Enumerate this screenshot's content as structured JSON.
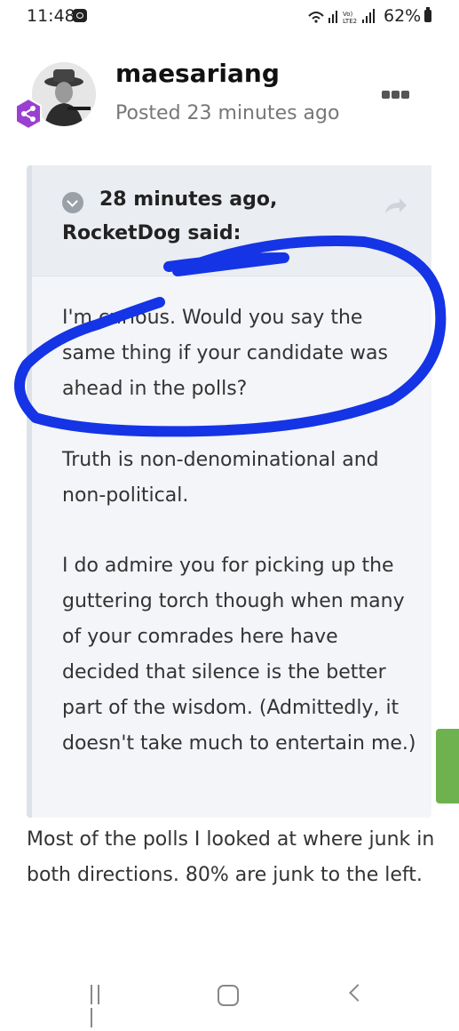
{
  "status_bar": {
    "time": "11:48",
    "battery": "62%",
    "icons": [
      "notification-icon",
      "wifi-icon",
      "signal-icon",
      "volte-icon",
      "battery-icon"
    ]
  },
  "post": {
    "author": "maesariang",
    "posted": "Posted 23 minutes ago",
    "quote": {
      "time": "28 minutes ago,",
      "user": "RocketDog said:",
      "paragraphs": [
        "I'm curious. Would you say the same thing if your candidate was ahead in the polls?",
        "Truth is non-denominational and non-political.",
        "I do admire you for picking up the guttering torch though when many of your comrades here have decided that silence is the better part of the wisdom. (Admittedly, it doesn't take much to entertain me.)"
      ]
    },
    "reply": "Most of the polls I looked at where junk in both directions. 80% are junk to the left."
  },
  "colors": {
    "annotation": "#1434e6",
    "quote_bg": "#f3f5f8",
    "accent_green": "#6db24e",
    "badge": "#9b3fd1"
  }
}
